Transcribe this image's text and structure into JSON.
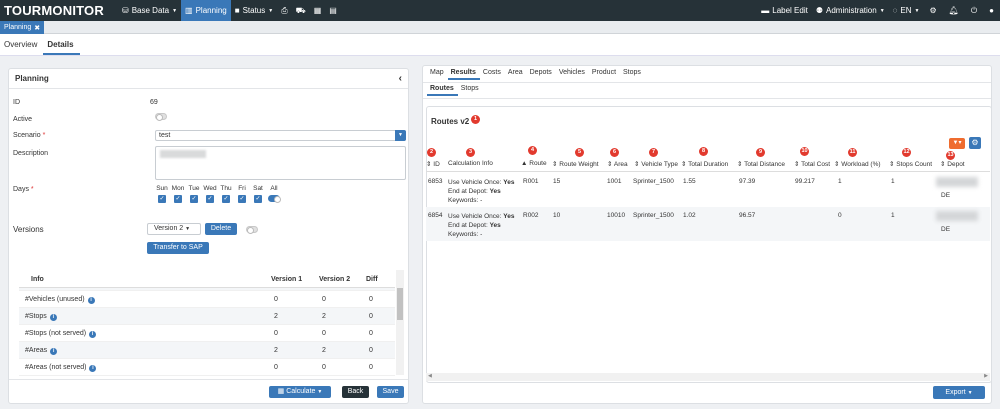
{
  "app": {
    "logo": "TOURMONITOR",
    "nav": [
      {
        "label": "Base Data",
        "icon": "database-icon"
      },
      {
        "label": "Planning",
        "icon": "chart-icon"
      },
      {
        "label": "Status",
        "icon": "video-icon"
      }
    ],
    "right_nav": {
      "label_edit": "Label Edit",
      "administration": "Administration",
      "language": "EN"
    },
    "colors": {
      "topbar": "#263238",
      "accent": "#3a78b8",
      "marker": "#e23a2e",
      "filter": "#ef6c2f"
    }
  },
  "doc_tab": {
    "label": "Planning",
    "close": "✖"
  },
  "subnav": {
    "overview": "Overview",
    "details": "Details"
  },
  "planning": {
    "title": "Planning",
    "id_label": "ID",
    "id_value": "69",
    "active_label": "Active",
    "scenario_label": "Scenario",
    "scenario_value": "test",
    "description_label": "Description",
    "days_label": "Days",
    "days": [
      "Sun",
      "Mon",
      "Tue",
      "Wed",
      "Thu",
      "Fri",
      "Sat",
      "All"
    ],
    "versions_label": "Versions",
    "version_select": "Version 2",
    "delete_label": "Delete",
    "transfer_label": "Transfer to SAP",
    "table_headers": {
      "info": "Info",
      "v1": "Version 1",
      "v2": "Version 2",
      "diff": "Diff"
    },
    "rows": [
      {
        "info": "#Vehicles (unused)",
        "v1": "0",
        "v2": "0",
        "diff": "0"
      },
      {
        "info": "#Stops",
        "v1": "2",
        "v2": "2",
        "diff": "0"
      },
      {
        "info": "#Stops (not served)",
        "v1": "0",
        "v2": "0",
        "diff": "0"
      },
      {
        "info": "#Areas",
        "v1": "2",
        "v2": "2",
        "diff": "0"
      },
      {
        "info": "#Areas (not served)",
        "v1": "0",
        "v2": "0",
        "diff": "0"
      }
    ],
    "calculate_label": "Calculate",
    "back_label": "Back",
    "save_label": "Save"
  },
  "results": {
    "tabs": [
      "Map",
      "Results",
      "Costs",
      "Area",
      "Depots",
      "Vehicles",
      "Product",
      "Stops"
    ],
    "subtabs": [
      "Routes",
      "Stops"
    ],
    "title": "Routes v2",
    "markers": [
      "1",
      "2",
      "3",
      "4",
      "5",
      "6",
      "7",
      "8",
      "9",
      "10",
      "11",
      "12",
      "13"
    ],
    "headers": [
      "ID",
      "Calculation Info",
      "Route",
      "Route Weight",
      "Area",
      "Vehicle Type",
      "Total Duration",
      "Total Distance",
      "Total Cost",
      "Workload (%)",
      "Stops Count",
      "Depot"
    ],
    "calc_labels": {
      "use_vehicle": "Use Vehicle Once:",
      "end_at_depot": "End at Depot:",
      "keywords": "Keywords: -"
    },
    "rows": [
      {
        "id": "6853",
        "use_vehicle": "Yes",
        "end_at_depot": "Yes",
        "route": "R001",
        "weight": "15",
        "area": "1001",
        "vehicle": "Sprinter_1500",
        "duration": "1.55",
        "distance": "97.39",
        "cost": "99.217",
        "workload": "1",
        "stops": "1",
        "depot": ""
      },
      {
        "id": "6854",
        "use_vehicle": "Yes",
        "end_at_depot": "Yes",
        "route": "R002",
        "weight": "10",
        "area": "10010",
        "vehicle": "Sprinter_1500",
        "duration": "1.02",
        "distance": "96.57",
        "cost": "",
        "workload": "0",
        "stops": "1",
        "depot": "DE"
      }
    ],
    "row1_depot_extra": "DE",
    "export_label": "Export"
  }
}
